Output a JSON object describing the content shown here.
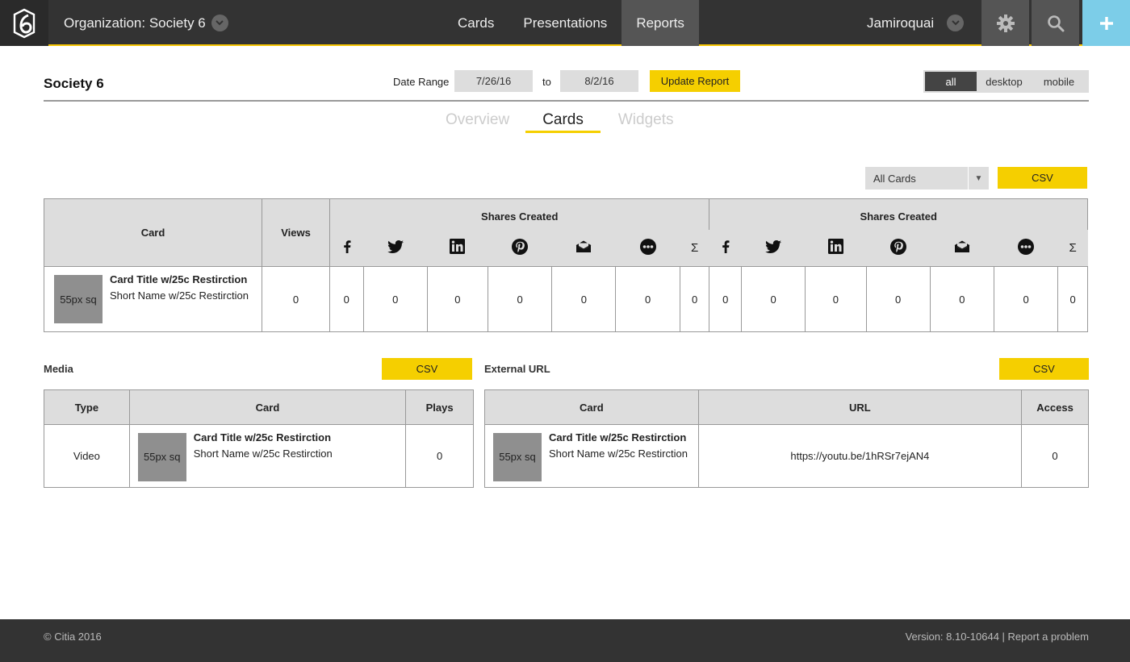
{
  "nav": {
    "organization_label": "Organization: Society 6",
    "links": [
      "Cards",
      "Presentations",
      "Reports"
    ],
    "active_link": "Reports",
    "user_name": "Jamiroquai"
  },
  "header": {
    "title": "Society 6",
    "date_range_label": "Date Range",
    "date_from": "7/26/16",
    "to_label": "to",
    "date_to": "8/2/16",
    "update_button": "Update Report",
    "device_options": [
      "all",
      "desktop",
      "mobile"
    ],
    "device_selected": "all"
  },
  "tabs": {
    "items": [
      "Overview",
      "Cards",
      "Widgets"
    ],
    "active": "Cards"
  },
  "filter": {
    "select_value": "All Cards",
    "csv_label": "CSV"
  },
  "cards_table": {
    "headers": {
      "card": "Card",
      "views": "Views",
      "shares_group_1": "Shares Created",
      "shares_group_2": "Shares Created",
      "sum_symbol": "Σ"
    },
    "share_icons": [
      "facebook-icon",
      "twitter-icon",
      "linkedin-icon",
      "pinterest-icon",
      "email-icon",
      "more-icon",
      "sum-icon"
    ],
    "row": {
      "thumb": "55px sq",
      "title": "Card Title w/25c Restirction",
      "short_name": "Short Name w/25c Restirction",
      "views": "0",
      "group1": [
        "0",
        "0",
        "0",
        "0",
        "0",
        "0",
        "0"
      ],
      "group2": [
        "0",
        "0",
        "0",
        "0",
        "0",
        "0",
        "0"
      ]
    }
  },
  "media": {
    "label": "Media",
    "csv_label": "CSV",
    "headers": {
      "type": "Type",
      "card": "Card",
      "plays": "Plays"
    },
    "row": {
      "type": "Video",
      "thumb": "55px sq",
      "title": "Card Title w/25c Restirction",
      "short_name": "Short Name w/25c Restirction",
      "plays": "0"
    }
  },
  "external": {
    "label": "External URL",
    "csv_label": "CSV",
    "headers": {
      "card": "Card",
      "url": "URL",
      "access": "Access"
    },
    "row": {
      "thumb": "55px sq",
      "title": "Card Title w/25c Restirction",
      "short_name": "Short Name w/25c Restirction",
      "url": "https://youtu.be/1hRSr7ejAN4",
      "access": "0"
    }
  },
  "footer": {
    "copyright": "© Citia 2016",
    "version": "Version: 8.10-10644",
    "separator": " | ",
    "report_link": "Report a problem"
  },
  "colors": {
    "nav_bg": "#333333",
    "accent_yellow": "#f5cf00",
    "add_button": "#7ccde8",
    "table_header": "#dddddd"
  }
}
